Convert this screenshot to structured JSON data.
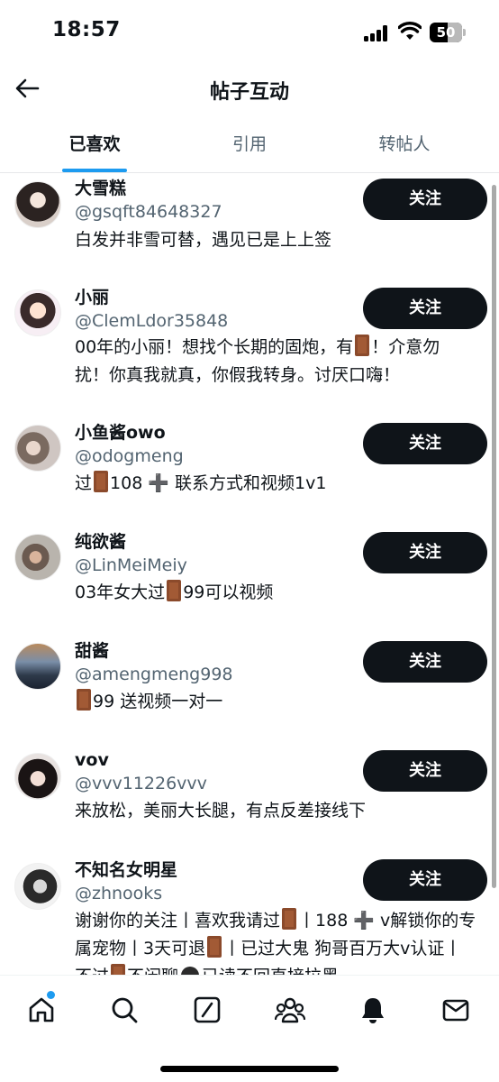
{
  "status_bar": {
    "time": "18:57",
    "battery": "50"
  },
  "header": {
    "title": "帖子互动"
  },
  "tabs": [
    {
      "label": "已喜欢",
      "active": true
    },
    {
      "label": "引用",
      "active": false
    },
    {
      "label": "转帖人",
      "active": false
    }
  ],
  "follow_label": "关注",
  "users": [
    {
      "name": "大雪糕",
      "handle": "@gsqft84648327",
      "bio": [
        "白发并非雪可替，遇见已是上上签"
      ]
    },
    {
      "name": "小丽",
      "handle": "@ClemLdor35848",
      "bio": [
        "00年的小丽！想找个长期的固炮，有",
        "！介意勿",
        "扰！你真我就真，你假我转身。讨厌口嗨！"
      ]
    },
    {
      "name": "小鱼酱owo",
      "handle": "@odogmeng",
      "bio": [
        "过",
        "108 ➕ 联系方式和视频1v1"
      ]
    },
    {
      "name": "纯欲酱",
      "handle": "@LinMeiMeiy",
      "bio": [
        "03年女大过",
        "99可以视频"
      ]
    },
    {
      "name": "甜酱",
      "handle": "@amengmeng998",
      "bio": [
        "",
        "99 送视频一对一"
      ]
    },
    {
      "name": "vov",
      "handle": "@vvv11226vvv",
      "bio": [
        "来放松，美丽大长腿，有点反差接线下"
      ]
    },
    {
      "name": "不知名女明星",
      "handle": "@zhnooks",
      "bio": [
        "谢谢你的关注丨喜欢我请过",
        "丨188 ➕ v解锁你的专",
        "属宠物丨3天可退",
        "丨已过大鬼 狗哥百万大v认证丨",
        "不过",
        "不闲聊",
        "已读不回直接拉黑"
      ]
    }
  ],
  "nav": [
    {
      "icon": "home-icon",
      "badge": true
    },
    {
      "icon": "search-icon",
      "badge": false
    },
    {
      "icon": "grok-icon",
      "badge": false
    },
    {
      "icon": "communities-icon",
      "badge": false
    },
    {
      "icon": "notifications-icon",
      "badge": false
    },
    {
      "icon": "messages-icon",
      "badge": false
    }
  ],
  "colors": {
    "accent": "#1d9bf0",
    "text": "#0f1419",
    "secondary": "#536471",
    "button_bg": "#0f1419"
  }
}
